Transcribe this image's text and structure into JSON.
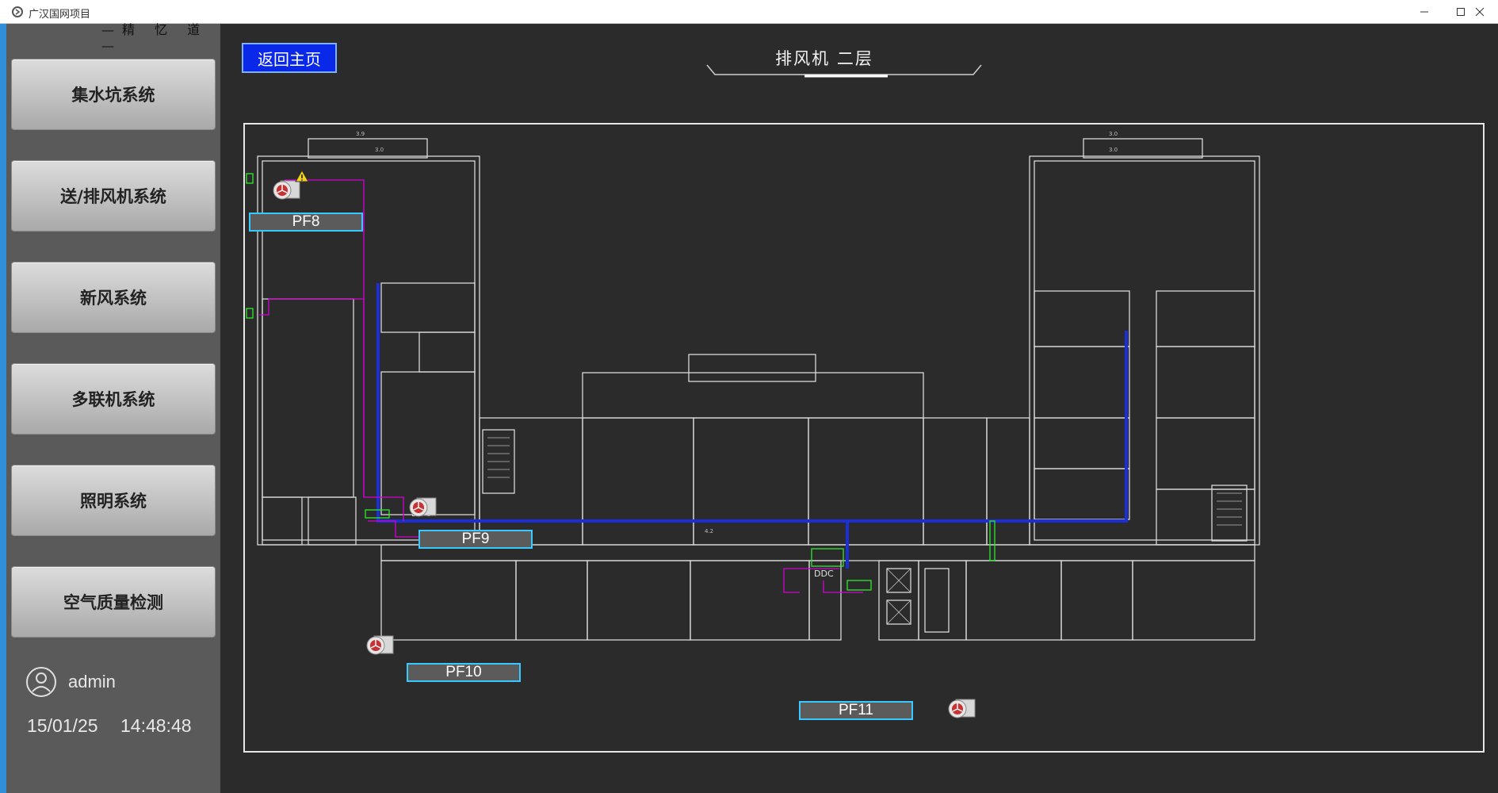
{
  "window": {
    "title": "广汉国网项目"
  },
  "sidebar": {
    "top_text": "—精 忆 道—",
    "items": [
      {
        "label": "集水坑系统"
      },
      {
        "label": "送/排风机系统"
      },
      {
        "label": "新风系统"
      },
      {
        "label": "多联机系统"
      },
      {
        "label": "照明系统"
      },
      {
        "label": "空气质量检测"
      }
    ],
    "user": "admin",
    "date": "15/01/25",
    "time": "14:48:48"
  },
  "main": {
    "back_label": "返回主页",
    "title": "排风机  二层",
    "fans": [
      {
        "label": "PF8",
        "status": "warning"
      },
      {
        "label": "PF9",
        "status": "normal"
      },
      {
        "label": "PF10",
        "status": "normal"
      },
      {
        "label": "PF11",
        "status": "normal"
      }
    ],
    "plan_labels": {
      "ddc1": "DDC",
      "ddc2": "DDC",
      "dim1": "3.9",
      "dim2": "3.0",
      "dim3": "3.0",
      "dim4": "3.0",
      "dim5": "4.2"
    }
  },
  "colors": {
    "accent": "#2f8fd8",
    "button_blue": "#0a28e8",
    "label_border": "#39c8ff",
    "wiring_magenta": "#d400d4",
    "duct_blue": "#1a2fd8"
  }
}
